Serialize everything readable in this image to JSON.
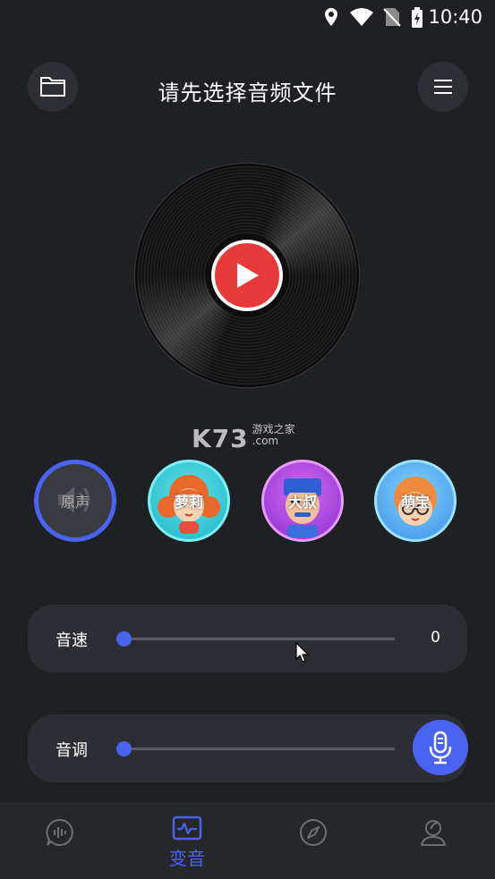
{
  "status_bar": {
    "time": "10:40"
  },
  "header": {
    "title": "请先选择音频文件"
  },
  "watermark": {
    "big": "K73",
    "line1": "游戏之家",
    "line2": ".com"
  },
  "voices": [
    {
      "label": "原声",
      "selected": true
    },
    {
      "label": "萝莉",
      "selected": false
    },
    {
      "label": "大叔",
      "selected": false
    },
    {
      "label": "萌宝",
      "selected": false
    }
  ],
  "speed": {
    "label": "音速",
    "value": "0",
    "level": 0
  },
  "pitch": {
    "label": "音调",
    "level": 0
  },
  "bottom_nav": {
    "items": [
      {
        "icon": "voice-chat-icon",
        "label": ""
      },
      {
        "icon": "waveform-icon",
        "label": "变音",
        "active": true
      },
      {
        "icon": "compass-icon",
        "label": ""
      },
      {
        "icon": "profile-icon",
        "label": ""
      }
    ]
  },
  "colors": {
    "accent": "#4b63f2",
    "background": "#1f2024",
    "card": "#2d2e33",
    "play": "#e8393a"
  }
}
